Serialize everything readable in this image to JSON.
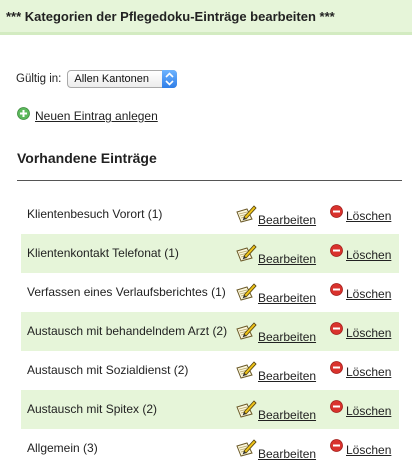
{
  "header": {
    "title": "*** Kategorien der Pflegedoku-Einträge bearbeiten ***"
  },
  "filter": {
    "label": "Gültig in:",
    "selected": "Allen Kantonen"
  },
  "add": {
    "label": "Neuen Eintrag anlegen",
    "icon": "add-circle-icon"
  },
  "section": {
    "title": "Vorhandene Einträge"
  },
  "actions": {
    "edit_label": "Bearbeiten",
    "delete_label": "Löschen",
    "edit_icon": "pencil-paper-icon",
    "delete_icon": "minus-circle-icon"
  },
  "colors": {
    "header_bg": "#e6f5d9",
    "row_alt_bg": "#e6f5d9",
    "add_green": "#5cb85c",
    "delete_red": "#d9322d"
  },
  "entries": [
    {
      "label": "Klientenbesuch Vorort (1)"
    },
    {
      "label": "Klientenkontakt Telefonat (1)"
    },
    {
      "label": "Verfassen eines Verlaufsberichtes (1)"
    },
    {
      "label": "Austausch mit behandelndem Arzt (2)"
    },
    {
      "label": "Austausch mit Sozialdienst (2)"
    },
    {
      "label": "Austausch mit Spitex (2)"
    },
    {
      "label": "Allgemein (3)"
    }
  ]
}
